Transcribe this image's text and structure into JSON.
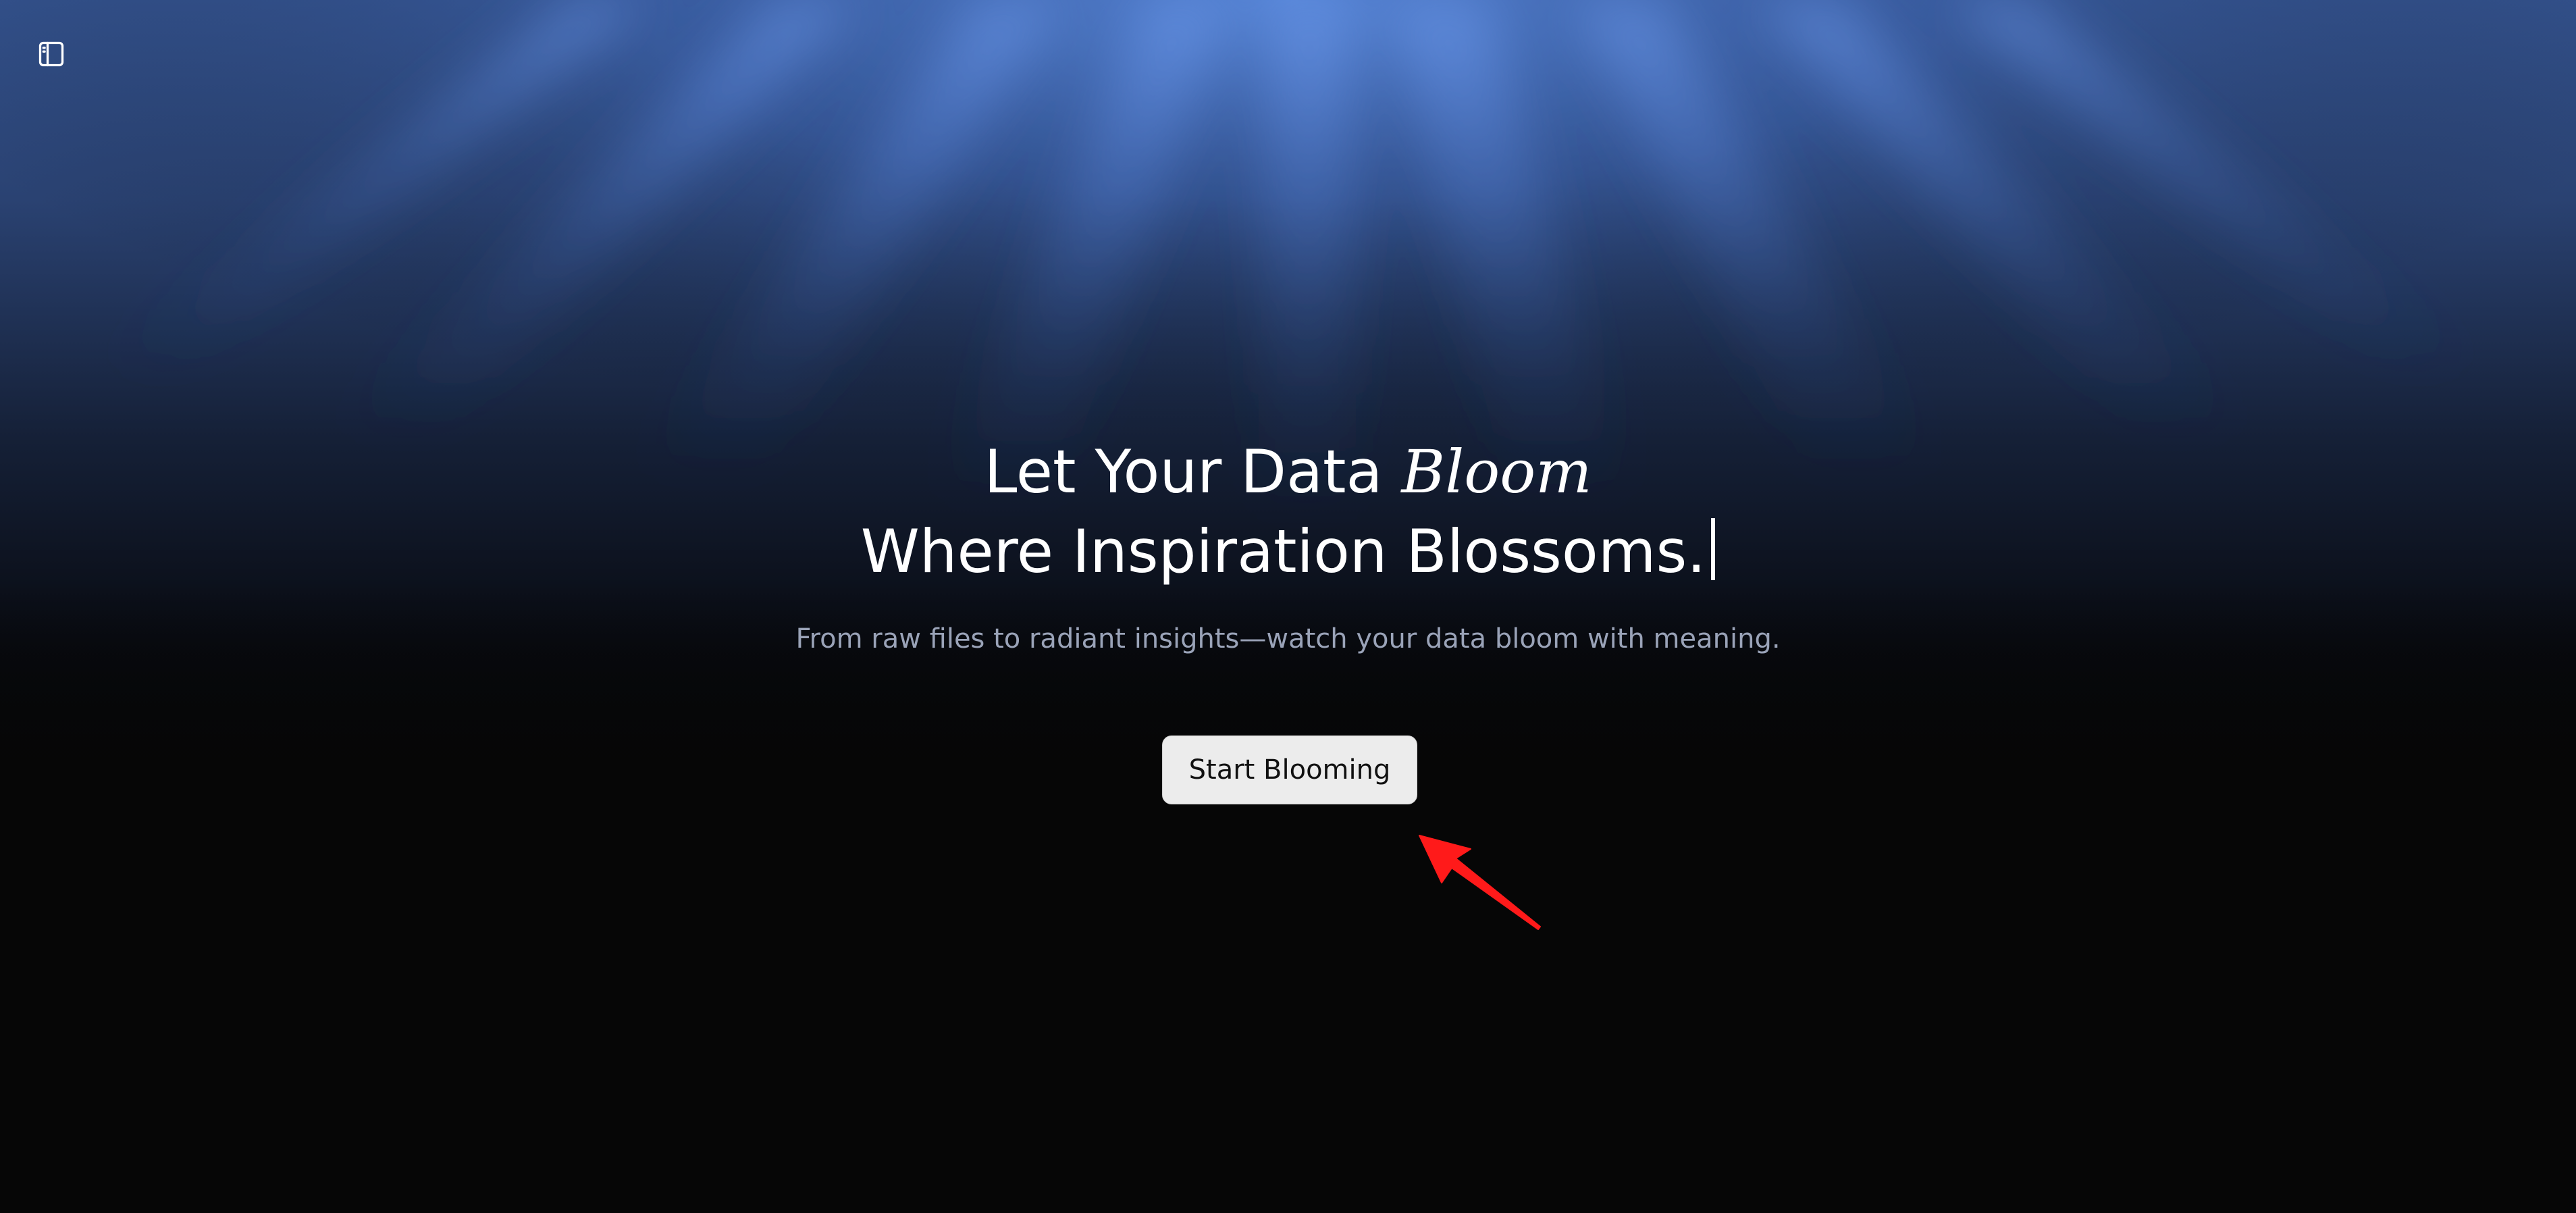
{
  "sidebar_toggle": {
    "icon": "sidebar-toggle-icon"
  },
  "hero": {
    "headline_prefix": "Let Your Data ",
    "headline_accent": "Bloom",
    "headline_line2": "Where Inspiration Blossoms.",
    "subtitle": "From raw files to radiant insights—watch your data bloom with meaning."
  },
  "cta": {
    "label": "Start Blooming"
  },
  "annotation": {
    "icon": "red-arrow-icon",
    "color": "#ff1a1a"
  },
  "colors": {
    "background": "#060606",
    "glow": "#4a7bd4",
    "text": "#ffffff",
    "subtitle": "#9aa3b8",
    "button_bg": "#ececec"
  }
}
